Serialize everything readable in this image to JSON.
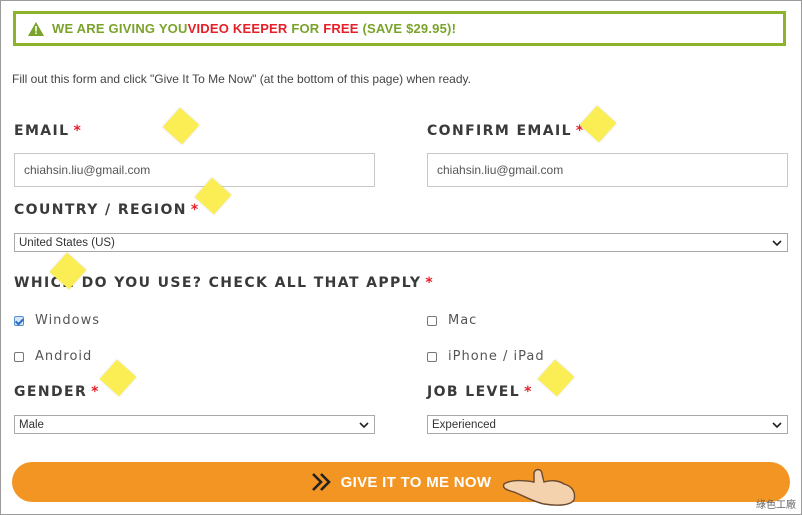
{
  "banner": {
    "part1": "WE ARE GIVING YOU ",
    "part2": "VIDEO KEEPER",
    "part3": " FOR ",
    "part4": "FREE",
    "part5": " (SAVE $29.95)!"
  },
  "intro": "Fill out this form and click \"Give It To Me Now\" (at the bottom of this page) when ready.",
  "fields": {
    "email_label": "EMAIL",
    "email_value": "chiahsin.liu@gmail.com",
    "confirm_label": "CONFIRM EMAIL",
    "confirm_value": "chiahsin.liu@gmail.com",
    "country_label": "COUNTRY / REGION",
    "country_value": "United States (US)",
    "platform_label": "WHICH DO YOU USE? CHECK ALL THAT APPLY",
    "gender_label": "GENDER",
    "gender_value": "Male",
    "job_label": "JOB LEVEL",
    "job_value": "Experienced",
    "required_mark": "*"
  },
  "platforms": [
    {
      "label": "Windows",
      "checked": true
    },
    {
      "label": "Mac",
      "checked": false
    },
    {
      "label": "Android",
      "checked": false
    },
    {
      "label": "iPhone / iPad",
      "checked": false
    }
  ],
  "cta_label": "GIVE IT TO ME NOW",
  "watermark": "綠色工廠",
  "colors": {
    "accent": "#f39522",
    "banner_border": "#8cb32a",
    "required": "#e5202a"
  }
}
